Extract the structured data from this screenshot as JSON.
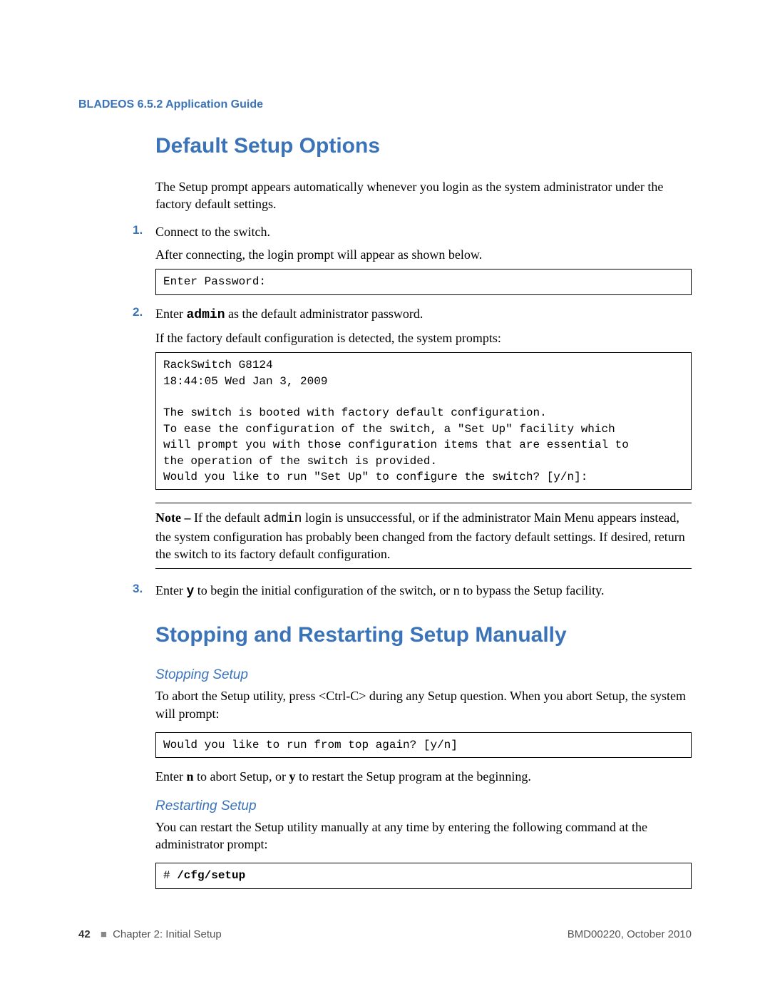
{
  "header": {
    "doc_title": "BLADEOS 6.5.2 Application Guide"
  },
  "section1": {
    "heading": "Default Setup Options",
    "intro": "The Setup prompt appears automatically whenever you login as the system administrator under the factory default settings.",
    "step1_num": "1.",
    "step1_a": "Connect to the switch.",
    "step1_b": "After connecting, the login prompt will appear as shown below.",
    "code1": "Enter Password:",
    "step2_num": "2.",
    "step2_a_pre": "Enter ",
    "step2_a_bold": "admin",
    "step2_a_post": " as the default administrator password.",
    "step2_b": "If the factory default configuration is detected, the system prompts:",
    "code2": "RackSwitch G8124\n18:44:05 Wed Jan 3, 2009\n\nThe switch is booted with factory default configuration.\nTo ease the configuration of the switch, a \"Set Up\" facility which\nwill prompt you with those configuration items that are essential to\nthe operation of the switch is provided.\nWould you like to run \"Set Up\" to configure the switch? [y/n]:",
    "note_label": "Note – ",
    "note_pre": "If the default ",
    "note_mono": "admin",
    "note_post": " login is unsuccessful, or if the administrator Main Menu appears instead, the system configuration has probably been changed from the factory default settings. If desired, return the switch to its factory default configuration.",
    "step3_num": "3.",
    "step3_pre": "Enter ",
    "step3_bold": "y",
    "step3_post": " to begin the initial configuration of the switch, or n to bypass the Setup facility."
  },
  "section2": {
    "heading": "Stopping and Restarting Setup Manually",
    "sub1": "Stopping Setup",
    "p1": "To abort the Setup utility, press <Ctrl-C> during any Setup question. When you abort Setup, the system will prompt:",
    "code3": "Would you like to run from top again? [y/n]",
    "p2_pre": "Enter ",
    "p2_b1": "n",
    "p2_mid": " to abort Setup, or ",
    "p2_b2": "y",
    "p2_post": " to restart the Setup program at the beginning.",
    "sub2": "Restarting Setup",
    "p3": "You can restart the Setup utility manually at any time by entering the following command at the administrator prompt:",
    "code4_prompt": "# ",
    "code4_cmd": "/cfg/setup"
  },
  "footer": {
    "page_num": "42",
    "chapter": "Chapter 2: Initial Setup",
    "doc_id": "BMD00220, October 2010"
  }
}
